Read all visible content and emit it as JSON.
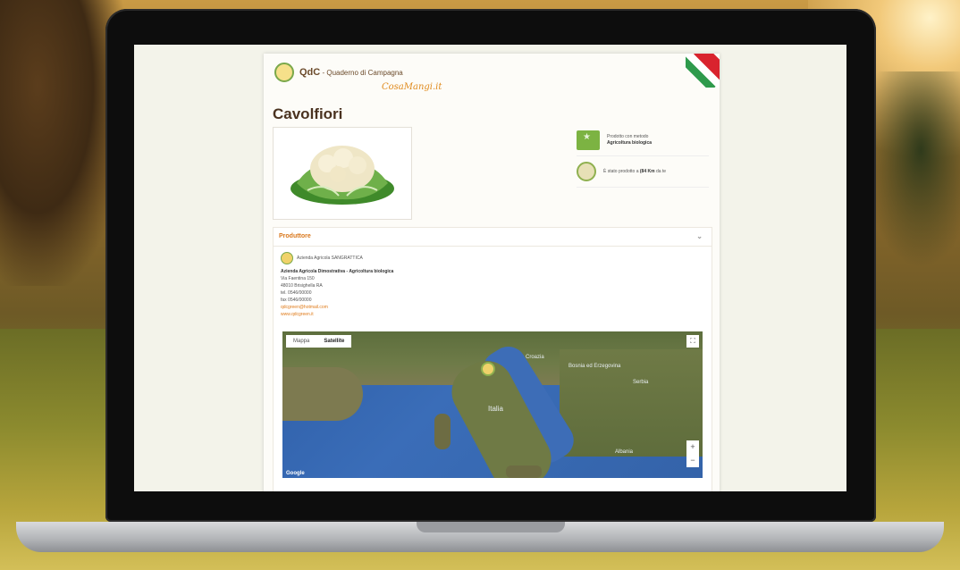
{
  "brand": {
    "name": "QdC",
    "subtitle": " - Quaderno di Campagna",
    "script": "CosaMangi.it"
  },
  "product": {
    "title": "Cavolfiori"
  },
  "certifications": [
    {
      "line1": "Prodotto con metodo",
      "line2": "Agricoltura biologica"
    },
    {
      "line1": "È stato prodotto a",
      "bold": "(84 Km",
      "line2": "da te"
    }
  ],
  "section": {
    "title": "Produttore",
    "chevron": "⌄"
  },
  "producer": {
    "logo_text": "Azienda Agricola SANGRATTICA",
    "name": "Azienda Agricola Dimostrativa - Agricoltura biologica",
    "address": "Via Faentina 150",
    "city": "48010 Brisighella RA",
    "tel": "tel. 0546/00000",
    "fax": "fax 0546/00000",
    "email": "qdcgreen@hotmail.com",
    "web": "www.qdcgreen.it"
  },
  "map": {
    "btn_map": "Mappa",
    "btn_satellite": "Satellite",
    "fullscreen": "⛶",
    "zoom_in": "+",
    "zoom_out": "−",
    "labels": {
      "italia": "Italia",
      "croazia": "Croazia",
      "bosnia": "Bosnia ed Erzegovina",
      "serbia": "Serbia",
      "albania": "Albania"
    },
    "attribution": "Google"
  }
}
